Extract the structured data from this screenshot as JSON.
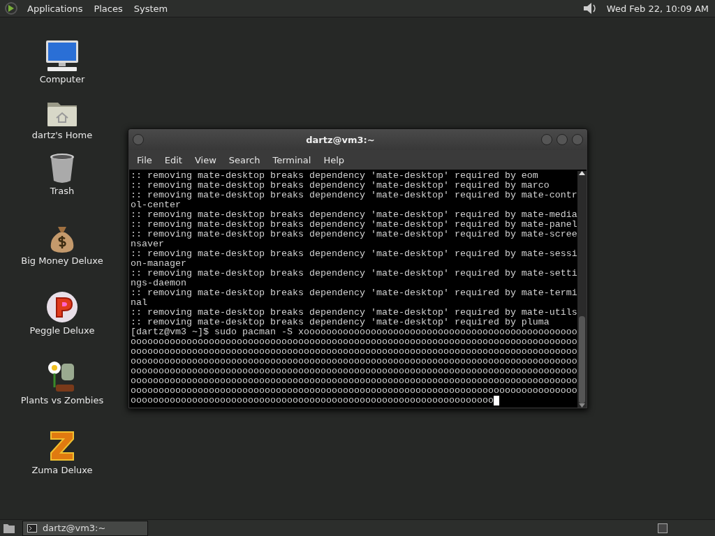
{
  "top_panel": {
    "menus": [
      "Applications",
      "Places",
      "System"
    ],
    "clock": "Wed Feb 22, 10:09 AM"
  },
  "desktop_icons": [
    {
      "kind": "computer",
      "label": "Computer"
    },
    {
      "kind": "home",
      "label": "dartz's Home"
    },
    {
      "kind": "trash",
      "label": "Trash"
    },
    {
      "kind": "money",
      "label": "Big Money Deluxe"
    },
    {
      "kind": "peggle",
      "label": "Peggle Deluxe"
    },
    {
      "kind": "plants",
      "label": "Plants vs Zombies"
    },
    {
      "kind": "zuma",
      "label": "Zuma Deluxe"
    }
  ],
  "terminal_window": {
    "title": "dartz@vm3:~",
    "menu": [
      "File",
      "Edit",
      "View",
      "Search",
      "Terminal",
      "Help"
    ],
    "lines": [
      ":: removing mate-desktop breaks dependency 'mate-desktop' required by eom",
      ":: removing mate-desktop breaks dependency 'mate-desktop' required by marco",
      ":: removing mate-desktop breaks dependency 'mate-desktop' required by mate-contr",
      "ol-center",
      ":: removing mate-desktop breaks dependency 'mate-desktop' required by mate-media",
      ":: removing mate-desktop breaks dependency 'mate-desktop' required by mate-panel",
      ":: removing mate-desktop breaks dependency 'mate-desktop' required by mate-scree",
      "nsaver",
      ":: removing mate-desktop breaks dependency 'mate-desktop' required by mate-sessi",
      "on-manager",
      ":: removing mate-desktop breaks dependency 'mate-desktop' required by mate-setti",
      "ngs-daemon",
      ":: removing mate-desktop breaks dependency 'mate-desktop' required by mate-termi",
      "nal",
      ":: removing mate-desktop breaks dependency 'mate-desktop' required by mate-utils",
      ":: removing mate-desktop breaks dependency 'mate-desktop' required by pluma",
      "[dartz@vm3 ~]$ sudo pacman -S xooooooooooooooooooooooooooooooooooooooooooooooooo",
      "oooooooooooooooooooooooooooooooooooooooooooooooooooooooooooooooooooooooooooooooo",
      "oooooooooooooooooooooooooooooooooooooooooooooooooooooooooooooooooooooooooooooooo",
      "oooooooooooooooooooooooooooooooooooooooooooooooooooooooooooooooooooooooooooooooo",
      "oooooooooooooooooooooooooooooooooooooooooooooooooooooooooooooooooooooooooooooooo",
      "oooooooooooooooooooooooooooooooooooooooooooooooooooooooooooooooooooooooooooooooo",
      "oooooooooooooooooooooooooooooooooooooooooooooooooooooooooooooooooooooooooooooooo",
      "ooooooooooooooooooooooooooooooooooooooooooooooooooooooooooooooooo"
    ]
  },
  "taskbar": {
    "tasks": [
      {
        "label": "dartz@vm3:~",
        "selected": true
      }
    ]
  }
}
